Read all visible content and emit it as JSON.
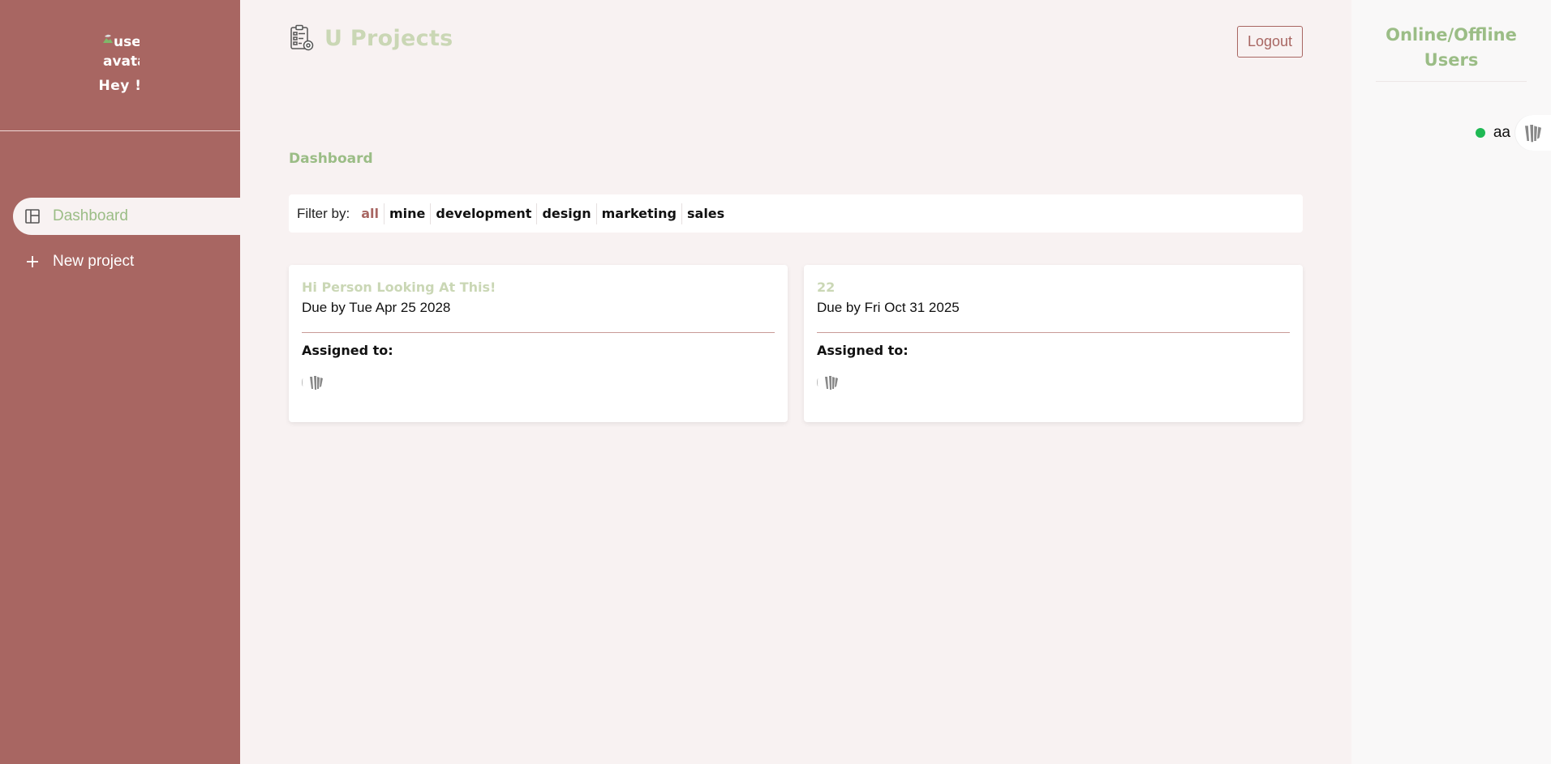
{
  "sidebar": {
    "avatar_alt_line1": "user",
    "avatar_alt_line2": "avatar",
    "greeting": "Hey !",
    "nav": [
      {
        "label": "Dashboard",
        "icon": "dashboard-icon",
        "active": true
      },
      {
        "label": "New project",
        "icon": "plus-icon",
        "active": false
      }
    ]
  },
  "header": {
    "title": "U Projects",
    "logout_label": "Logout"
  },
  "main": {
    "page_title": "Dashboard",
    "filter": {
      "label": "Filter by:",
      "options": [
        "all",
        "mine",
        "development",
        "design",
        "marketing",
        "sales"
      ],
      "selected": "all"
    },
    "projects": [
      {
        "name": "Hi Person Looking At This!",
        "due": "Due by Tue Apr 25 2028",
        "assigned_label": "Assigned to:"
      },
      {
        "name": "22",
        "due": "Due by Fri Oct 31 2025",
        "assigned_label": "Assigned to:"
      }
    ]
  },
  "online_panel": {
    "title": "Online/Offline Users",
    "users": [
      {
        "name": "aa",
        "status": "online"
      }
    ]
  },
  "colors": {
    "sidebar_bg": "#a86662",
    "accent_green": "#9bbd86",
    "title_green": "#cad7b5",
    "online_green": "#1fb954",
    "page_bg": "#f8f2f2"
  }
}
